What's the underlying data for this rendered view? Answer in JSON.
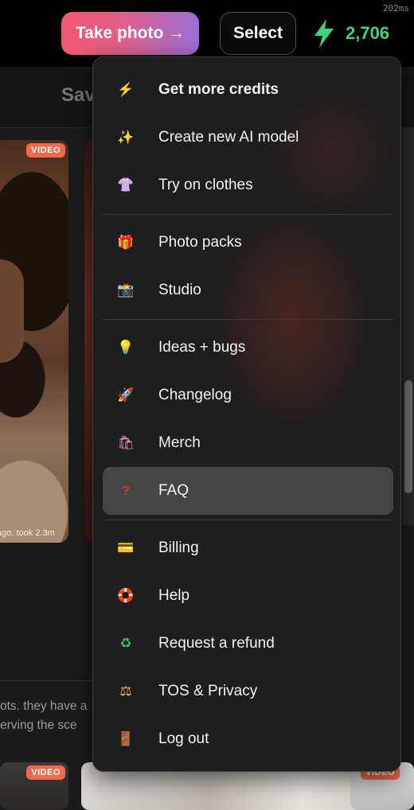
{
  "topbar": {
    "timing": "202ms",
    "take_photo_label": "Take photo →",
    "select_label": "Select",
    "credits_count": "2,706",
    "colors": {
      "credits": "#3ed67a",
      "take_photo_start": "#f0566f",
      "take_photo_end": "#9a6fd8"
    }
  },
  "subbar": {
    "tab_label": "Sav"
  },
  "gallery": {
    "video_badge": "VIDEO",
    "card_caption": "ago, took 2.3m",
    "description_line1": "ots. they have a",
    "description_line2": "erving the sce"
  },
  "menu": {
    "items": [
      {
        "icon": "lightning-icon",
        "label": "Get more credits"
      },
      {
        "icon": "sparkles-icon",
        "label": "Create new AI model"
      },
      {
        "icon": "shirt-icon",
        "label": "Try on clothes"
      },
      {
        "icon": "gift-icon",
        "label": "Photo packs"
      },
      {
        "icon": "camera-flash-icon",
        "label": "Studio"
      },
      {
        "icon": "light-bulb-icon",
        "label": "Ideas + bugs"
      },
      {
        "icon": "rocket-icon",
        "label": "Changelog"
      },
      {
        "icon": "shopping-bags-icon",
        "label": "Merch"
      },
      {
        "icon": "question-mark-icon",
        "label": "FAQ"
      },
      {
        "icon": "credit-card-icon",
        "label": "Billing"
      },
      {
        "icon": "life-buoy-icon",
        "label": "Help"
      },
      {
        "icon": "recycle-icon",
        "label": "Request a refund"
      },
      {
        "icon": "judge-icon",
        "label": "TOS & Privacy"
      },
      {
        "icon": "door-icon",
        "label": "Log out"
      }
    ],
    "highlighted_item": "FAQ"
  }
}
